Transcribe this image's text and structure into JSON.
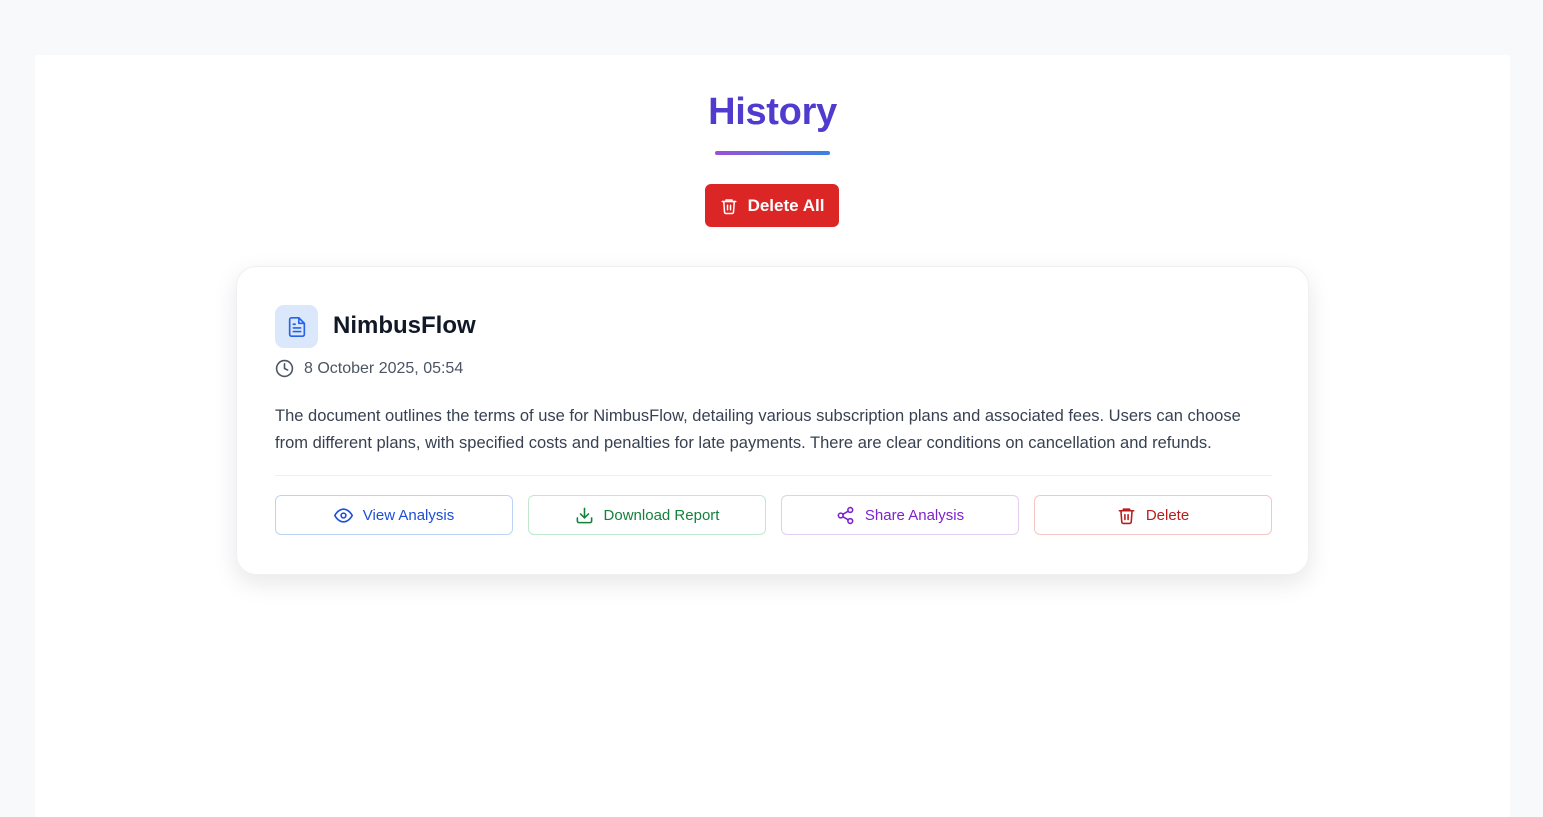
{
  "page": {
    "title": "History",
    "delete_all_label": "Delete All"
  },
  "history": {
    "items": [
      {
        "name": "NimbusFlow",
        "date": "8 October 2025, 05:54",
        "summary": "The document outlines the terms of use for NimbusFlow, detailing various subscription plans and associated fees. Users can choose from different plans, with specified costs and penalties for late payments. There are clear conditions on cancellation and refunds.",
        "actions": {
          "view": "View Analysis",
          "download": "Download Report",
          "share": "Share Analysis",
          "delete": "Delete"
        }
      }
    ]
  },
  "colors": {
    "title": "#4f3ccf",
    "danger": "#dc2626",
    "view": "#1d4ed8",
    "download": "#15803d",
    "share": "#7e22ce",
    "delete": "#b91c1c"
  },
  "icons": {
    "delete_all": "trash-icon",
    "document": "document-icon",
    "date": "clock-icon",
    "view": "eye-icon",
    "download": "download-icon",
    "share": "share-icon",
    "delete": "trash-icon"
  }
}
